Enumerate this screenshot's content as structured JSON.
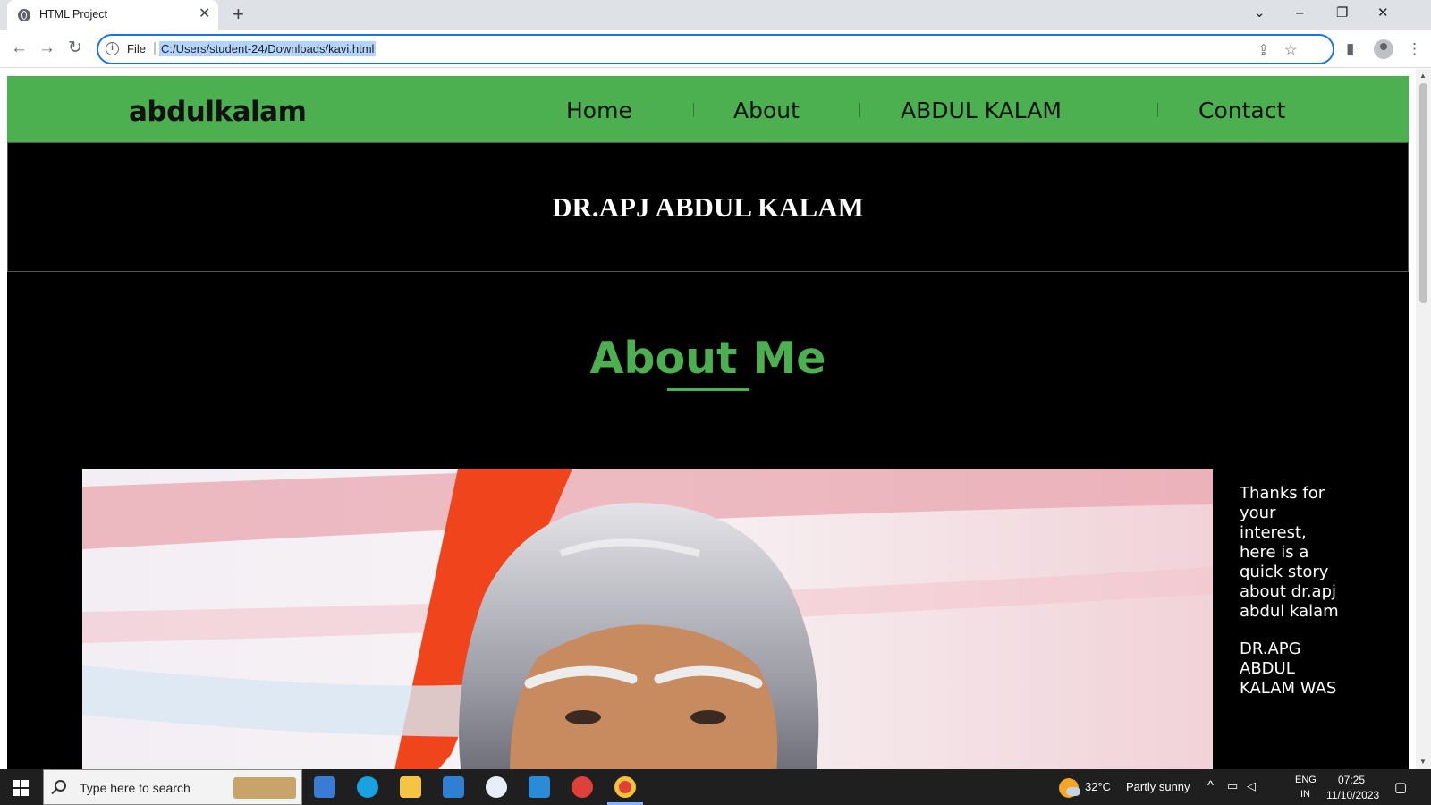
{
  "browser": {
    "tab_title": "HTML Project",
    "tab_close": "✕",
    "new_tab": "+",
    "win_chevron": "⌄",
    "win_minimize": "–",
    "win_restore": "❐",
    "win_close": "✕",
    "back": "←",
    "forward": "→",
    "reload": "↻",
    "scheme_label": "File",
    "url": "C:/Users/student-24/Downloads/kavi.html",
    "star": "☆",
    "share": "⇪",
    "side_panel": "▮",
    "menu": "⋮"
  },
  "site": {
    "logo": "abdulkalam",
    "nav": [
      {
        "label": "Home"
      },
      {
        "label": "About"
      },
      {
        "label": "ABDUL KALAM"
      },
      {
        "label": "Contact"
      }
    ],
    "banner_title": "DR.APJ ABDUL KALAM",
    "about_title": "About Me",
    "about_paragraph_1": "Thanks for your interest, here is a quick story about dr.apj abdul kalam",
    "about_paragraph_2": "DR.APG ABDUL KALAM WAS",
    "theme_color": "#4caf50"
  },
  "taskbar": {
    "search_placeholder": "Type here to search",
    "weather_temp": "32°C",
    "weather_desc": "Partly sunny",
    "lang_top": "ENG",
    "lang_bottom": "IN",
    "time": "07:25",
    "date": "11/10/2023",
    "tray_chevron": "^"
  }
}
